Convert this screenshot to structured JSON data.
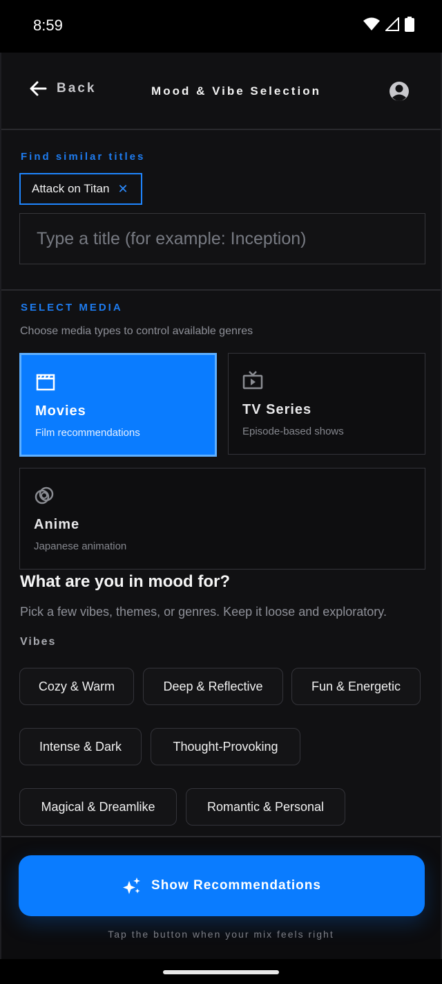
{
  "status": {
    "time": "8:59"
  },
  "header": {
    "back_label": "Back",
    "title": "Mood & Vibe Selection"
  },
  "similar": {
    "label": "Find similar titles",
    "selected_title": "Attack on Titan",
    "input_placeholder": "Type a title (for example: Inception)"
  },
  "media": {
    "label": "SELECT MEDIA",
    "subtitle": "Choose media types to control available genres",
    "options": [
      {
        "title": "Movies",
        "desc": "Film recommendations",
        "icon": "clapperboard-icon",
        "selected": true
      },
      {
        "title": "TV Series",
        "desc": "Episode-based shows",
        "icon": "tv-icon",
        "selected": false
      },
      {
        "title": "Anime",
        "desc": "Japanese animation",
        "icon": "rings-icon",
        "selected": false
      }
    ]
  },
  "mood": {
    "title": "What are you in mood for?",
    "subtitle": "Pick a few vibes, themes, or genres. Keep it loose and exploratory.",
    "vibes_label": "Vibes",
    "vibes": [
      "Cozy & Warm",
      "Deep & Reflective",
      "Fun & Energetic",
      "Intense & Dark",
      "Thought-Provoking",
      "Magical & Dreamlike",
      "Romantic & Personal"
    ]
  },
  "footer": {
    "cta_label": "Show Recommendations",
    "hint": "Tap the button when your mix feels right"
  },
  "colors": {
    "accent": "#0a7cff",
    "background": "#111113"
  }
}
